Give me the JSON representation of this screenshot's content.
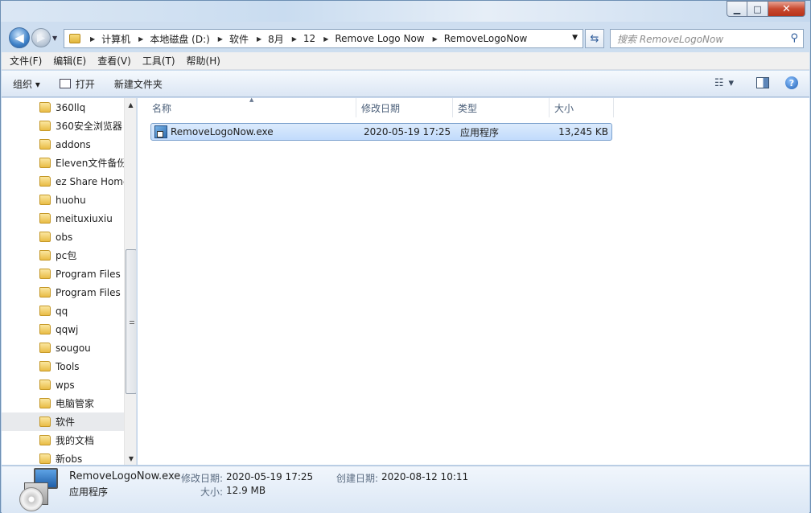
{
  "window": {
    "minimize_glyph": "▁",
    "maximize_glyph": "□",
    "close_glyph": "✕"
  },
  "nav": {
    "back_glyph": "◀",
    "forward_glyph": "▶",
    "breadcrumbs": [
      "计算机",
      "本地磁盘 (D:)",
      "软件",
      "8月",
      "12",
      "Remove Logo Now",
      "RemoveLogoNow"
    ],
    "search_placeholder": "搜索 RemoveLogoNow"
  },
  "menu": [
    "文件(F)",
    "编辑(E)",
    "查看(V)",
    "工具(T)",
    "帮助(H)"
  ],
  "toolbar": {
    "organize": "组织 ▾",
    "open": "打开",
    "new_folder": "新建文件夹",
    "help_glyph": "?"
  },
  "sidebar": {
    "items": [
      "360llq",
      "360安全浏览器",
      "addons",
      "Eleven文件备份",
      "ez Share Home",
      "huohu",
      "meituxiuxiu",
      "obs",
      "pc包",
      "Program Files",
      "Program Files",
      "qq",
      "qqwj",
      "sougou",
      "Tools",
      "wps",
      "电脑管家",
      "软件",
      "我的文档",
      "新obs"
    ],
    "selected_index": 17
  },
  "columns": {
    "name": "名称",
    "modified": "修改日期",
    "type": "类型",
    "size": "大小"
  },
  "files": [
    {
      "name": "RemoveLogoNow.exe",
      "modified": "2020-05-19 17:25",
      "type": "应用程序",
      "size": "13,245 KB"
    }
  ],
  "details": {
    "filename": "RemoveLogoNow.exe",
    "filetype": "应用程序",
    "modified_label": "修改日期:",
    "modified_value": "2020-05-19 17:25",
    "created_label": "创建日期:",
    "created_value": "2020-08-12 10:11",
    "size_label": "大小:",
    "size_value": "12.9 MB"
  }
}
